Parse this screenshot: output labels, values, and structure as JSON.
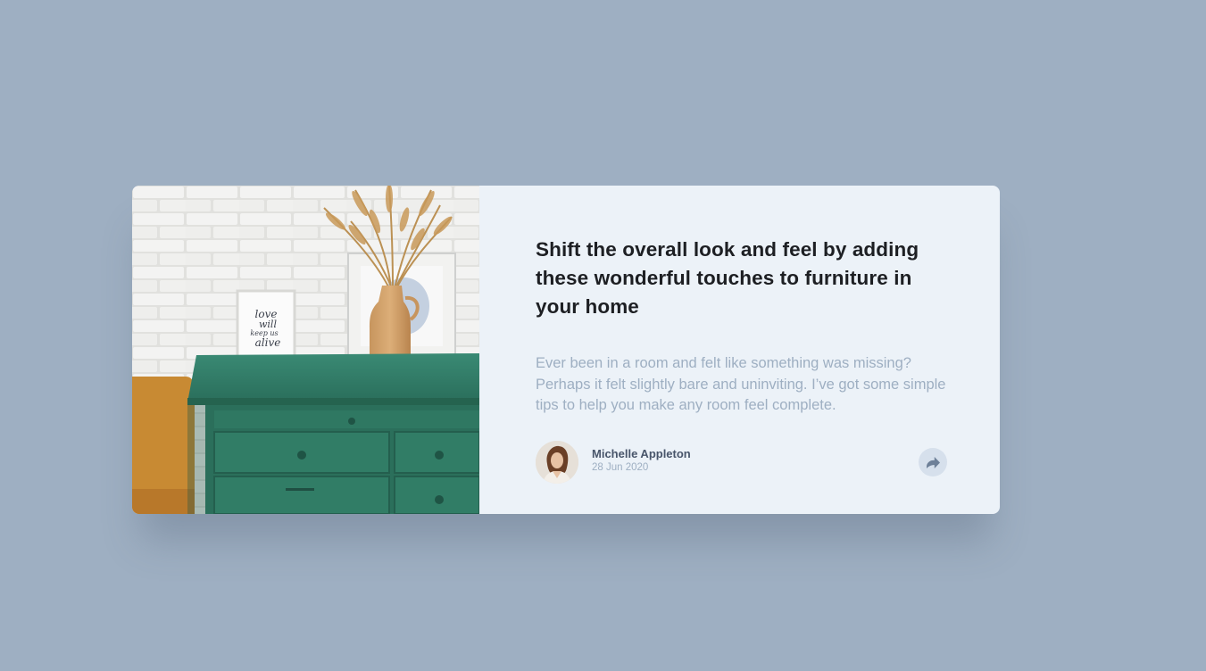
{
  "article": {
    "title": "Shift the overall look and feel by adding these wonderful touches to furniture in your home",
    "description": "Ever been in a room and felt like something was missing? Perhaps it felt slightly bare and uninviting. I’ve got some simple tips to help you make any room feel complete."
  },
  "image": {
    "frame_text_lines": [
      "love",
      "will",
      "keep us",
      "alive"
    ]
  },
  "author": {
    "name": "Michelle Appleton",
    "date": "28 Jun 2020"
  },
  "share": {
    "icon": "share-icon"
  },
  "colors": {
    "background": "#9eafc2",
    "card": "#ecf2f8",
    "title": "#1d1f23",
    "text_muted": "#9eafc2",
    "author_name": "#48556a",
    "share_button": "#d6e0ec",
    "share_icon": "#6e8098",
    "dresser": "#2e7a66"
  }
}
